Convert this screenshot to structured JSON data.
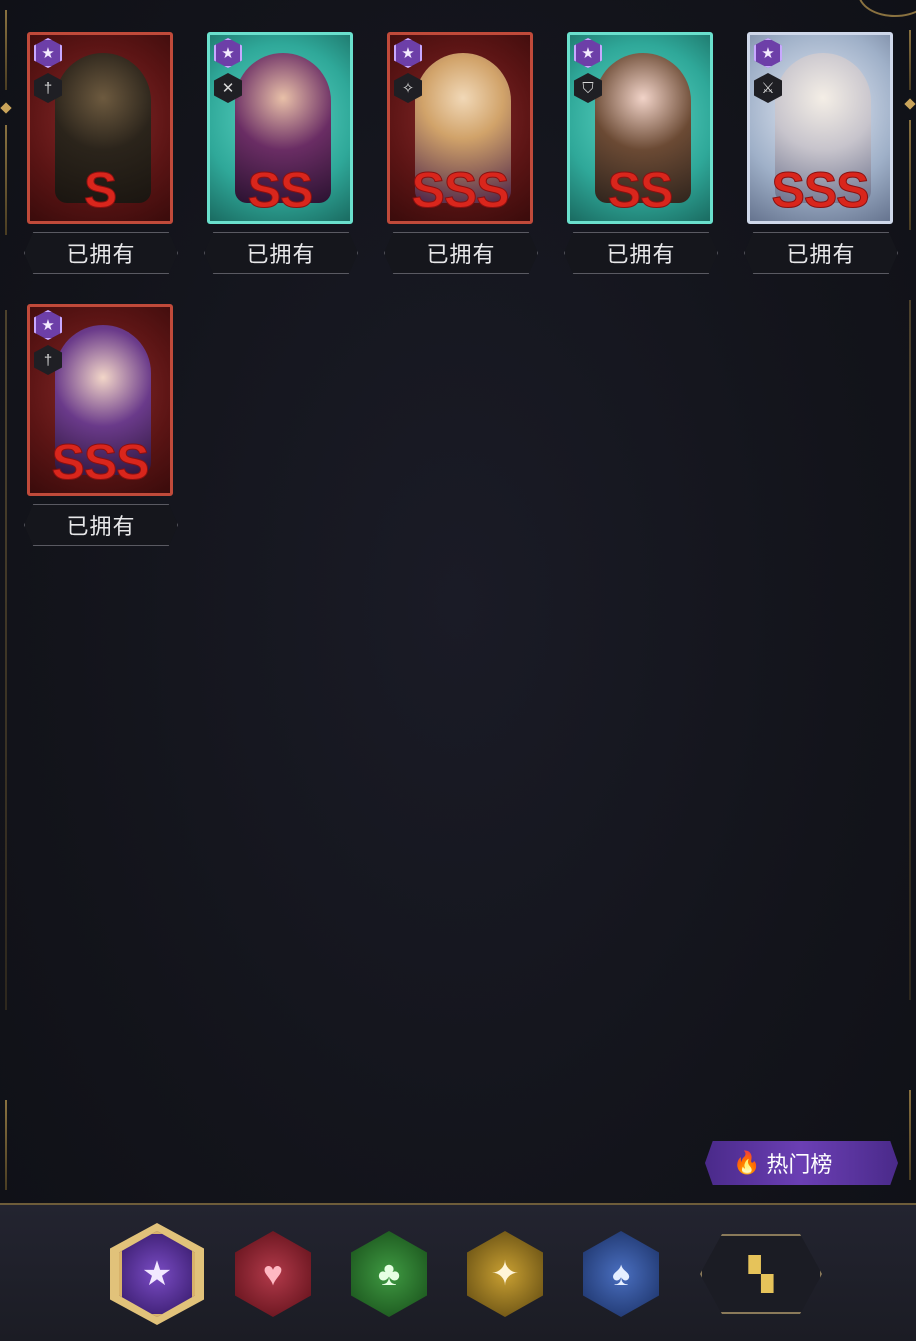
{
  "cards": [
    {
      "grade": "S",
      "owned": "已拥有",
      "frame": "red",
      "portrait": "p-dark",
      "role_icon": "dagger-icon"
    },
    {
      "grade": "SS",
      "owned": "已拥有",
      "frame": "teal",
      "portrait": "p-violet",
      "role_icon": "crossed-swords-icon"
    },
    {
      "grade": "SSS",
      "owned": "已拥有",
      "frame": "red",
      "portrait": "p-blonde",
      "role_icon": "bird-icon"
    },
    {
      "grade": "SS",
      "owned": "已拥有",
      "frame": "teal",
      "portrait": "p-brunette",
      "role_icon": "shield-icon"
    },
    {
      "grade": "SSS",
      "owned": "已拥有",
      "frame": "silver",
      "portrait": "p-white",
      "role_icon": "sword-icon"
    },
    {
      "grade": "SSS",
      "owned": "已拥有",
      "frame": "red",
      "portrait": "p-purplehair",
      "role_icon": "dagger-icon"
    }
  ],
  "hot_list": {
    "label": "热门榜",
    "icon": "flame-icon"
  },
  "tabs": [
    {
      "icon": "star-icon",
      "selected": true
    },
    {
      "icon": "heart-icon"
    },
    {
      "icon": "club-icon"
    },
    {
      "icon": "diamond-icon"
    },
    {
      "icon": "spade-icon"
    },
    {
      "icon": "grid-icon"
    }
  ],
  "colors": {
    "grade_red": "#d9261c",
    "accent_gold": "#c9a45a",
    "star_purple": "#6d3fa8"
  }
}
